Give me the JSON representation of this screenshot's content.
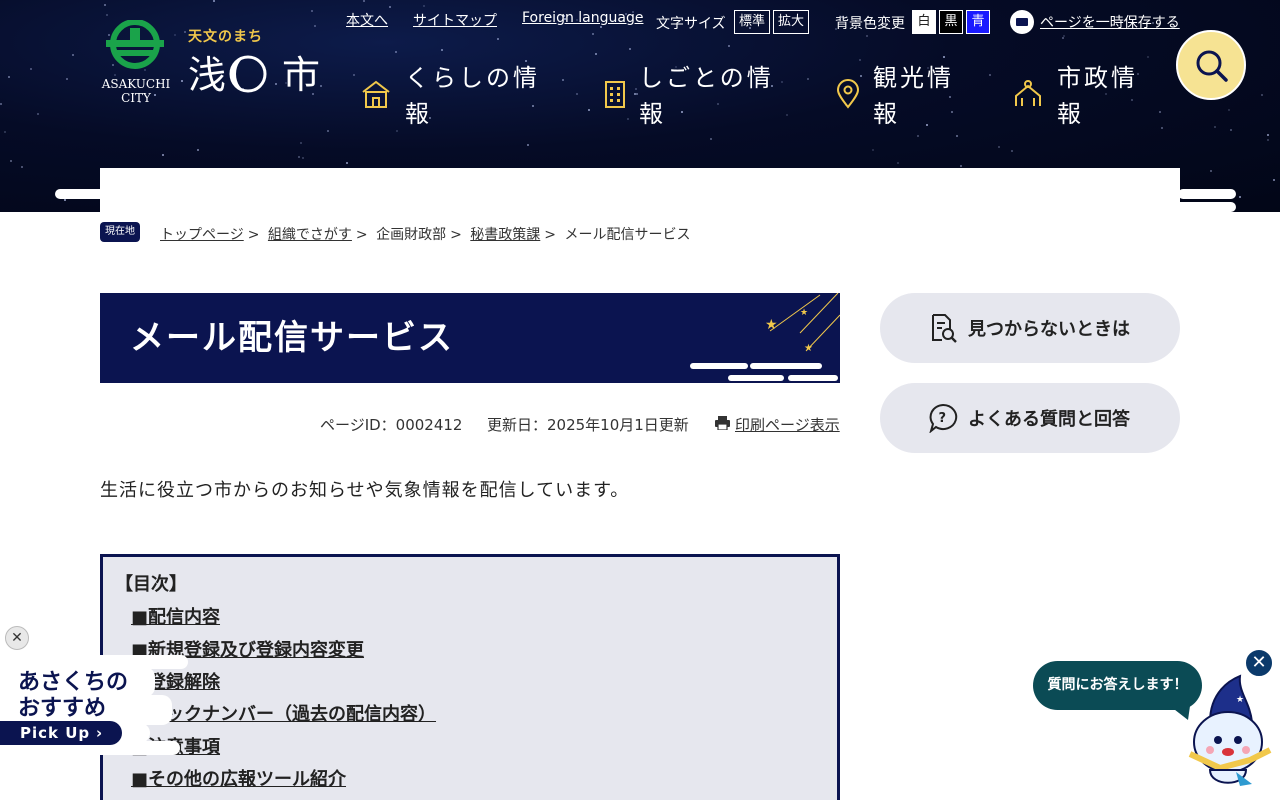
{
  "header": {
    "logo": {
      "tagline": "天文のまち",
      "name_left": "浅",
      "name_right": "市",
      "city_en_line1": "ASAKUCHI",
      "city_en_line2": "CITY"
    },
    "utility": {
      "skip_link": "本文へ",
      "sitemap_link": "サイトマップ",
      "foreign_link": "Foreign language",
      "text_size_label": "文字サイズ",
      "size_standard": "標準",
      "size_large": "拡大",
      "bg_color_label": "背景色変更",
      "bg_white": "白",
      "bg_black": "黒",
      "bg_blue": "青",
      "save_page_link": "ページを一時保存する"
    },
    "nav": [
      {
        "line1": "くらしの情",
        "line2": "報",
        "icon": "house-icon"
      },
      {
        "line1": "しごとの情",
        "line2": "報",
        "icon": "building-icon"
      },
      {
        "line1": "観光情",
        "line2": "報",
        "icon": "location-pin-icon"
      },
      {
        "line1": "市政情",
        "line2": "報",
        "icon": "city-hall-icon"
      }
    ],
    "search_icon": "search-icon"
  },
  "breadcrumb": {
    "badge": "現在地",
    "items": [
      {
        "label": "トップページ",
        "link": true
      },
      {
        "label": "組織でさがす",
        "link": true
      },
      {
        "label": "企画財政部",
        "link": false
      },
      {
        "label": "秘書政策課",
        "link": true
      },
      {
        "label": "メール配信サービス",
        "link": false
      }
    ],
    "separator": ">"
  },
  "main": {
    "title": "メール配信サービス",
    "page_id": "ページID：0002412",
    "updated": "更新日：2025年10月1日更新",
    "print_link": "印刷ページ表示",
    "lead": "生活に役立つ市からのお知らせや気象情報を配信しています。",
    "toc": {
      "title": "【目次】",
      "items": [
        "■配信内容",
        "■新規登録及び登録内容変更",
        "■登録解除",
        "■バックナンバー（過去の配信内容）",
        "■注意事項",
        "■その他の広報ツール紹介"
      ]
    }
  },
  "sidebar": {
    "not_found": "見つからないときは",
    "faq": "よくある質問と回答"
  },
  "pickup": {
    "close": "✕",
    "line1": "あさくちの",
    "line2": "おすすめ",
    "tag": "Pick Up"
  },
  "chatbot": {
    "bubble": "質問にお答えします！",
    "close": "✕"
  },
  "colors": {
    "navy": "#0b1450",
    "gold": "#f1c84b",
    "search_yellow": "#f6e393",
    "chat_teal": "#0b4b55",
    "light_gray": "#e6e7ee"
  }
}
